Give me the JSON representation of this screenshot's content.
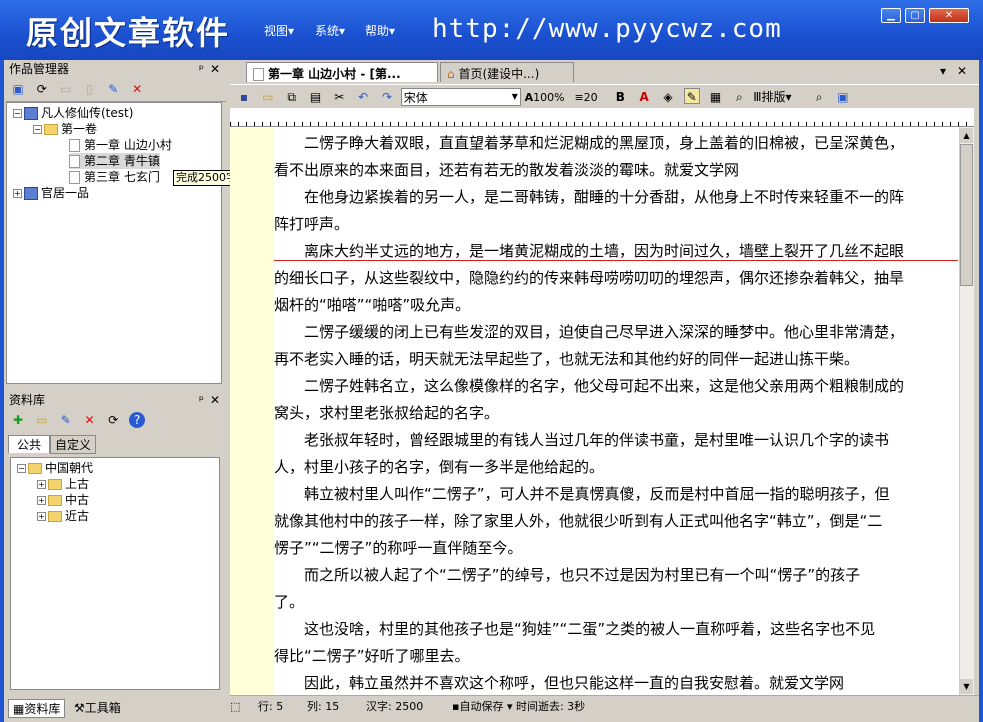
{
  "app": {
    "title": "原创文章软件",
    "url": "http://www.pyycwz.com",
    "menu": [
      "视图▾",
      "系统▾",
      "帮助▾"
    ]
  },
  "works_panel": {
    "title": "作品管理器",
    "pin": "ᵖ",
    "close": "✕",
    "tree": {
      "book": "凡人修仙传(test)",
      "volume": "第一卷",
      "chapters": [
        "第一章 山边小村",
        "第二章 青牛镇",
        "第三章 七玄门"
      ],
      "book2": "官居一品"
    },
    "tooltip": "完成2500字"
  },
  "library_panel": {
    "title": "资料库",
    "tabs": [
      "公共",
      "自定义"
    ],
    "tree": {
      "root": "中国朝代",
      "children": [
        "上古",
        "中古",
        "近古"
      ]
    }
  },
  "bottom_tabs": [
    "资料库",
    "工具箱"
  ],
  "editor": {
    "tabs": [
      "第一章 山边小村 - [第...",
      "首页(建设中...)"
    ],
    "toolbar": {
      "font": "宋体",
      "zoom": "100%",
      "line_spacing": "20",
      "bold": "B",
      "font_color": "A",
      "layout": "排版"
    },
    "paragraphs": [
      [
        "　　二愣子睁大着双眼，直直望着茅草和烂泥糊成的黑屋顶，身上盖着的旧棉被，已呈深黄色，",
        "看不出原来的本来面目，还若有若无的散发着淡淡的霉味。就爱文学网"
      ],
      [
        "　　在他身边紧挨着的另一人，是二哥韩铸，酣睡的十分香甜，从他身上不时传来轻重不一的阵",
        "阵打呼声。"
      ],
      [
        "　　离床大约半丈远的地方，是一堵黄泥糊成的土墙，因为时间过久，墙壁上裂开了几丝不起眼",
        "的细长口子，从这些裂纹中，隐隐约约的传来韩母唠唠叨叨的埋怨声，偶尔还掺杂着韩父，抽旱",
        "烟杆的“啪嗒”“啪嗒”吸允声。"
      ],
      [
        "　　二愣子缓缓的闭上已有些发涩的双目，迫使自己尽早进入深深的睡梦中。他心里非常清楚，",
        "再不老实入睡的话，明天就无法早起些了，也就无法和其他约好的同伴一起进山拣干柴。"
      ],
      [
        "　　二愣子姓韩名立，这么像模像样的名字，他父母可起不出来，这是他父亲用两个粗粮制成的",
        "窝头，求村里老张叔给起的名字。"
      ],
      [
        "　　老张叔年轻时，曾经跟城里的有钱人当过几年的伴读书童，是村里唯一认识几个字的读书",
        "人，村里小孩子的名字，倒有一多半是他给起的。"
      ],
      [
        "　　韩立被村里人叫作“二愣子”，可人并不是真愣真傻，反而是村中首屈一指的聪明孩子，但",
        "就像其他村中的孩子一样，除了家里人外，他就很少听到有人正式叫他名字“韩立”，倒是“二",
        "愣子”“二愣子”的称呼一直伴随至今。"
      ],
      [
        "　　而之所以被人起了个“二愣子”的绰号，也只不过是因为村里已有一个叫“愣子”的孩子",
        "了。"
      ],
      [
        "　　这也没啥，村里的其他孩子也是“狗娃”“二蛋”之类的被人一直称呼着，这些名字也不见",
        "得比“二愣子”好听了哪里去。"
      ],
      [
        "　　因此，韩立虽然并不喜欢这个称呼，但也只能这样一直的自我安慰着。就爱文学网"
      ]
    ]
  },
  "status": {
    "row": "行: 5",
    "col": "列: 15",
    "chars": "汉字: 2500",
    "autosave": "自动保存 ▾ 时间逝去: 3秒"
  }
}
